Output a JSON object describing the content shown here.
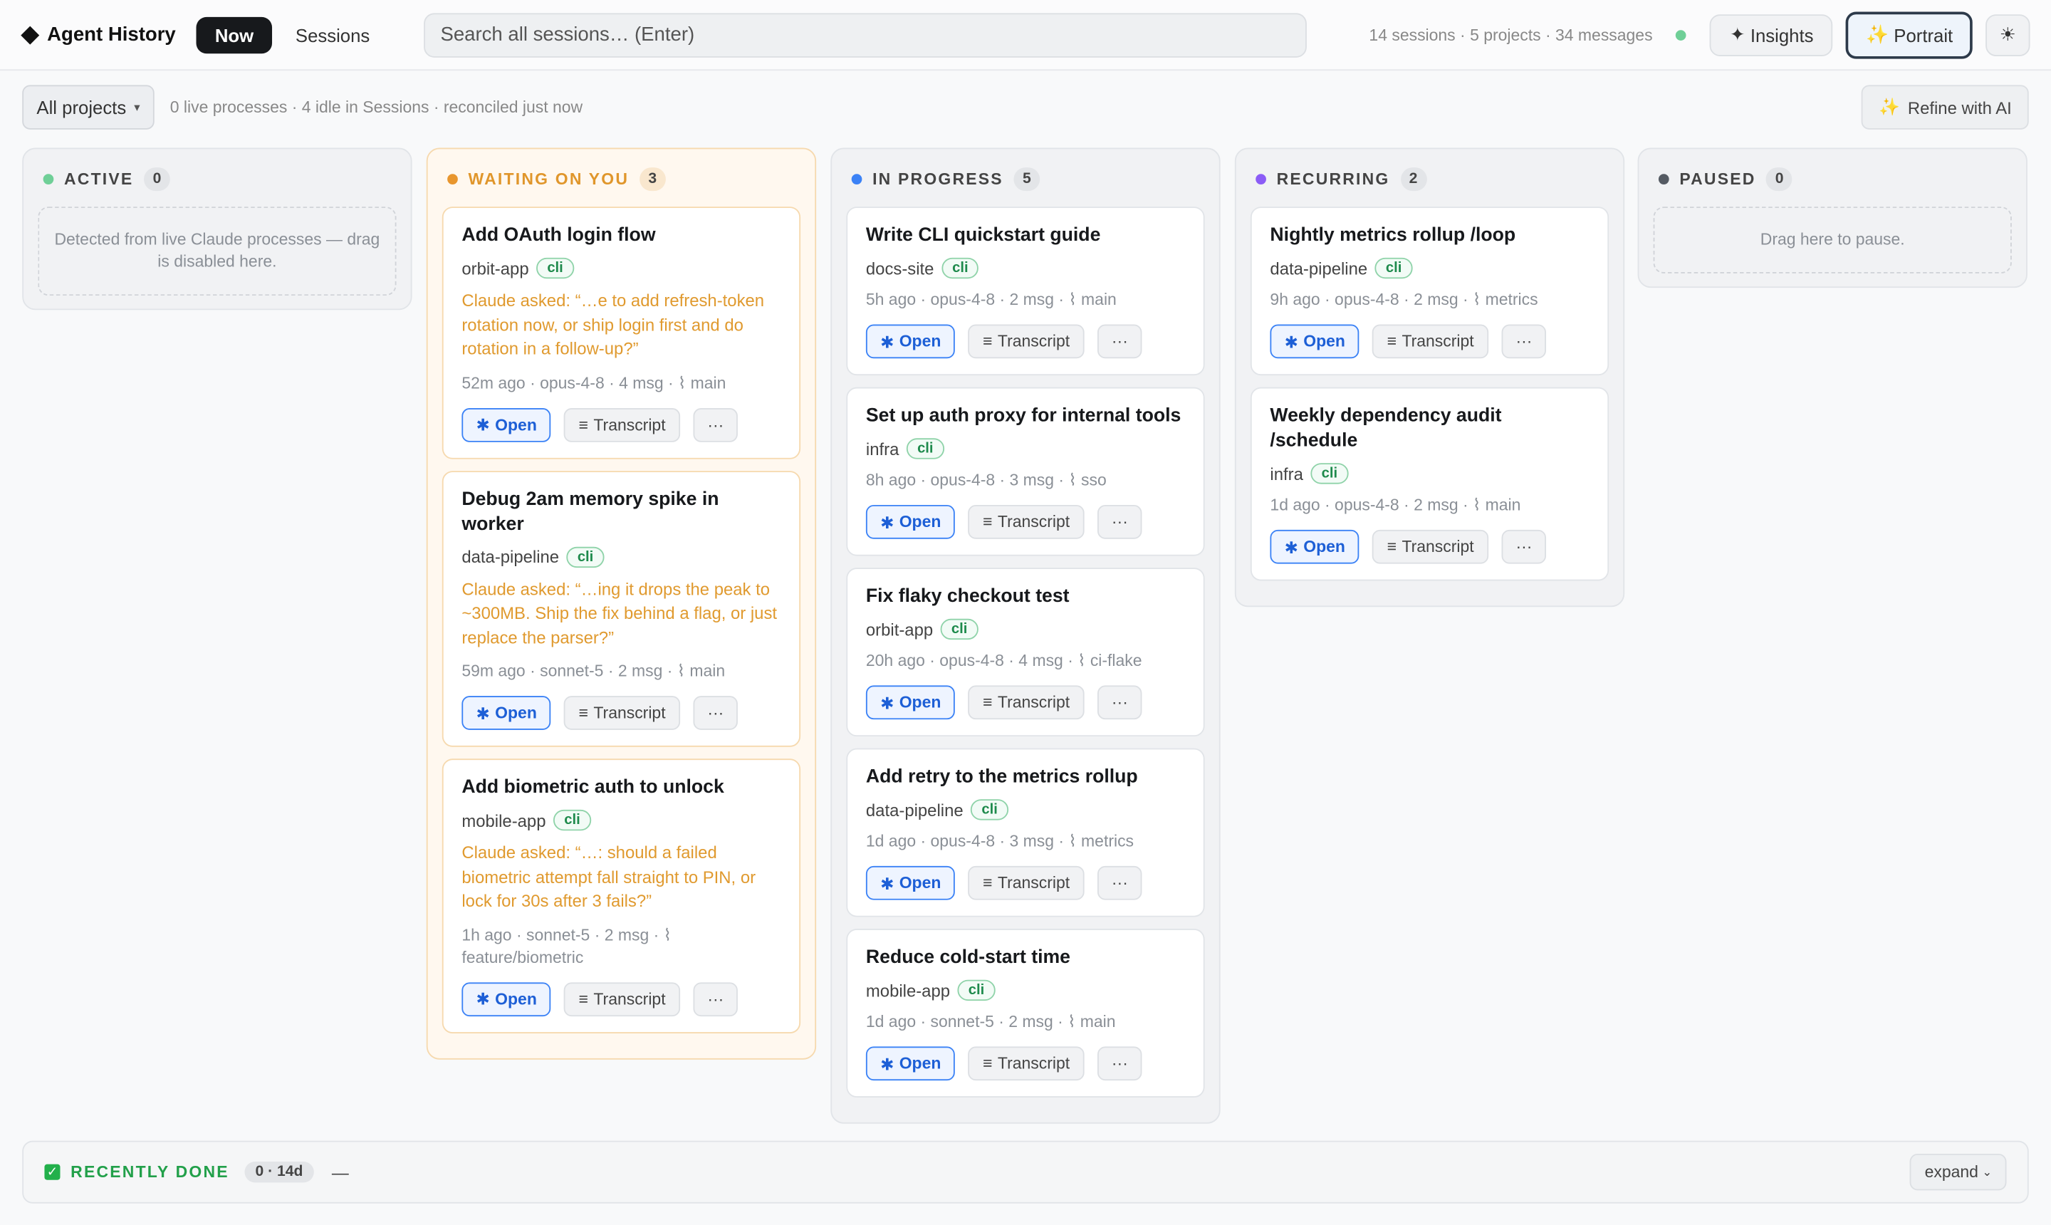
{
  "header": {
    "brand": "Agent History",
    "tabs": [
      {
        "label": "Now"
      },
      {
        "label": "Sessions"
      }
    ],
    "search_placeholder": "Search all sessions…  (Enter)",
    "stats": "14 sessions · 5 projects · 34 messages",
    "insights_label": "Insights",
    "portrait_label": "Portrait"
  },
  "subbar": {
    "project_filter": "All projects",
    "info": "0 live processes · 4 idle in Sessions · reconciled just now",
    "refine_label": "Refine with AI"
  },
  "labels": {
    "open": "Open",
    "transcript": "Transcript",
    "more": "···"
  },
  "columns": {
    "active": {
      "title": "ACTIVE",
      "count": "0",
      "color": "#6fcf97",
      "empty": "Detected from live Claude processes — drag is disabled here."
    },
    "waiting": {
      "title": "WAITING ON YOU",
      "count": "3",
      "color": "#e8962e",
      "cards": [
        {
          "title": "Add OAuth login flow",
          "project": "orbit-app",
          "tag": "cli",
          "asked": "Claude asked: “…e to add refresh-token rotation now, or ship login first and do rotation in a follow-up?”",
          "meta": "52m ago · opus-4-8 · 4 msg · ⌇ main"
        },
        {
          "title": "Debug 2am memory spike in worker",
          "project": "data-pipeline",
          "tag": "cli",
          "asked": "Claude asked: “…ing it drops the peak to ~300MB. Ship the fix behind a flag, or just replace the parser?”",
          "meta": "59m ago · sonnet-5 · 2 msg · ⌇ main"
        },
        {
          "title": "Add biometric auth to unlock",
          "project": "mobile-app",
          "tag": "cli",
          "asked": "Claude asked: “…: should a failed biometric attempt fall straight to PIN, or lock for 30s after 3 fails?”",
          "meta": "1h ago · sonnet-5 · 2 msg · ⌇ feature/biometric"
        }
      ]
    },
    "progress": {
      "title": "IN PROGRESS",
      "count": "5",
      "color": "#3b82f6",
      "cards": [
        {
          "title": "Write CLI quickstart guide",
          "project": "docs-site",
          "tag": "cli",
          "meta": "5h ago · opus-4-8 · 2 msg · ⌇ main"
        },
        {
          "title": "Set up auth proxy for internal tools",
          "project": "infra",
          "tag": "cli",
          "meta": "8h ago · opus-4-8 · 3 msg · ⌇ sso"
        },
        {
          "title": "Fix flaky checkout test",
          "project": "orbit-app",
          "tag": "cli",
          "meta": "20h ago · opus-4-8 · 4 msg · ⌇ ci-flake"
        },
        {
          "title": "Add retry to the metrics rollup",
          "project": "data-pipeline",
          "tag": "cli",
          "meta": "1d ago · opus-4-8 · 3 msg · ⌇ metrics"
        },
        {
          "title": "Reduce cold-start time",
          "project": "mobile-app",
          "tag": "cli",
          "meta": "1d ago · sonnet-5 · 2 msg · ⌇ main"
        }
      ]
    },
    "recurring": {
      "title": "RECURRING",
      "count": "2",
      "color": "#8b5cf6",
      "cards": [
        {
          "title": "Nightly metrics rollup /loop",
          "project": "data-pipeline",
          "tag": "cli",
          "meta": "9h ago · opus-4-8 · 2 msg · ⌇ metrics"
        },
        {
          "title": "Weekly dependency audit /schedule",
          "project": "infra",
          "tag": "cli",
          "meta": "1d ago · opus-4-8 · 2 msg · ⌇ main"
        }
      ]
    },
    "paused": {
      "title": "PAUSED",
      "count": "0",
      "color": "#555b63",
      "empty": "Drag here to pause."
    }
  },
  "done": {
    "title": "RECENTLY DONE",
    "count": "0 · 14d",
    "dash": "—",
    "expand_label": "expand"
  }
}
